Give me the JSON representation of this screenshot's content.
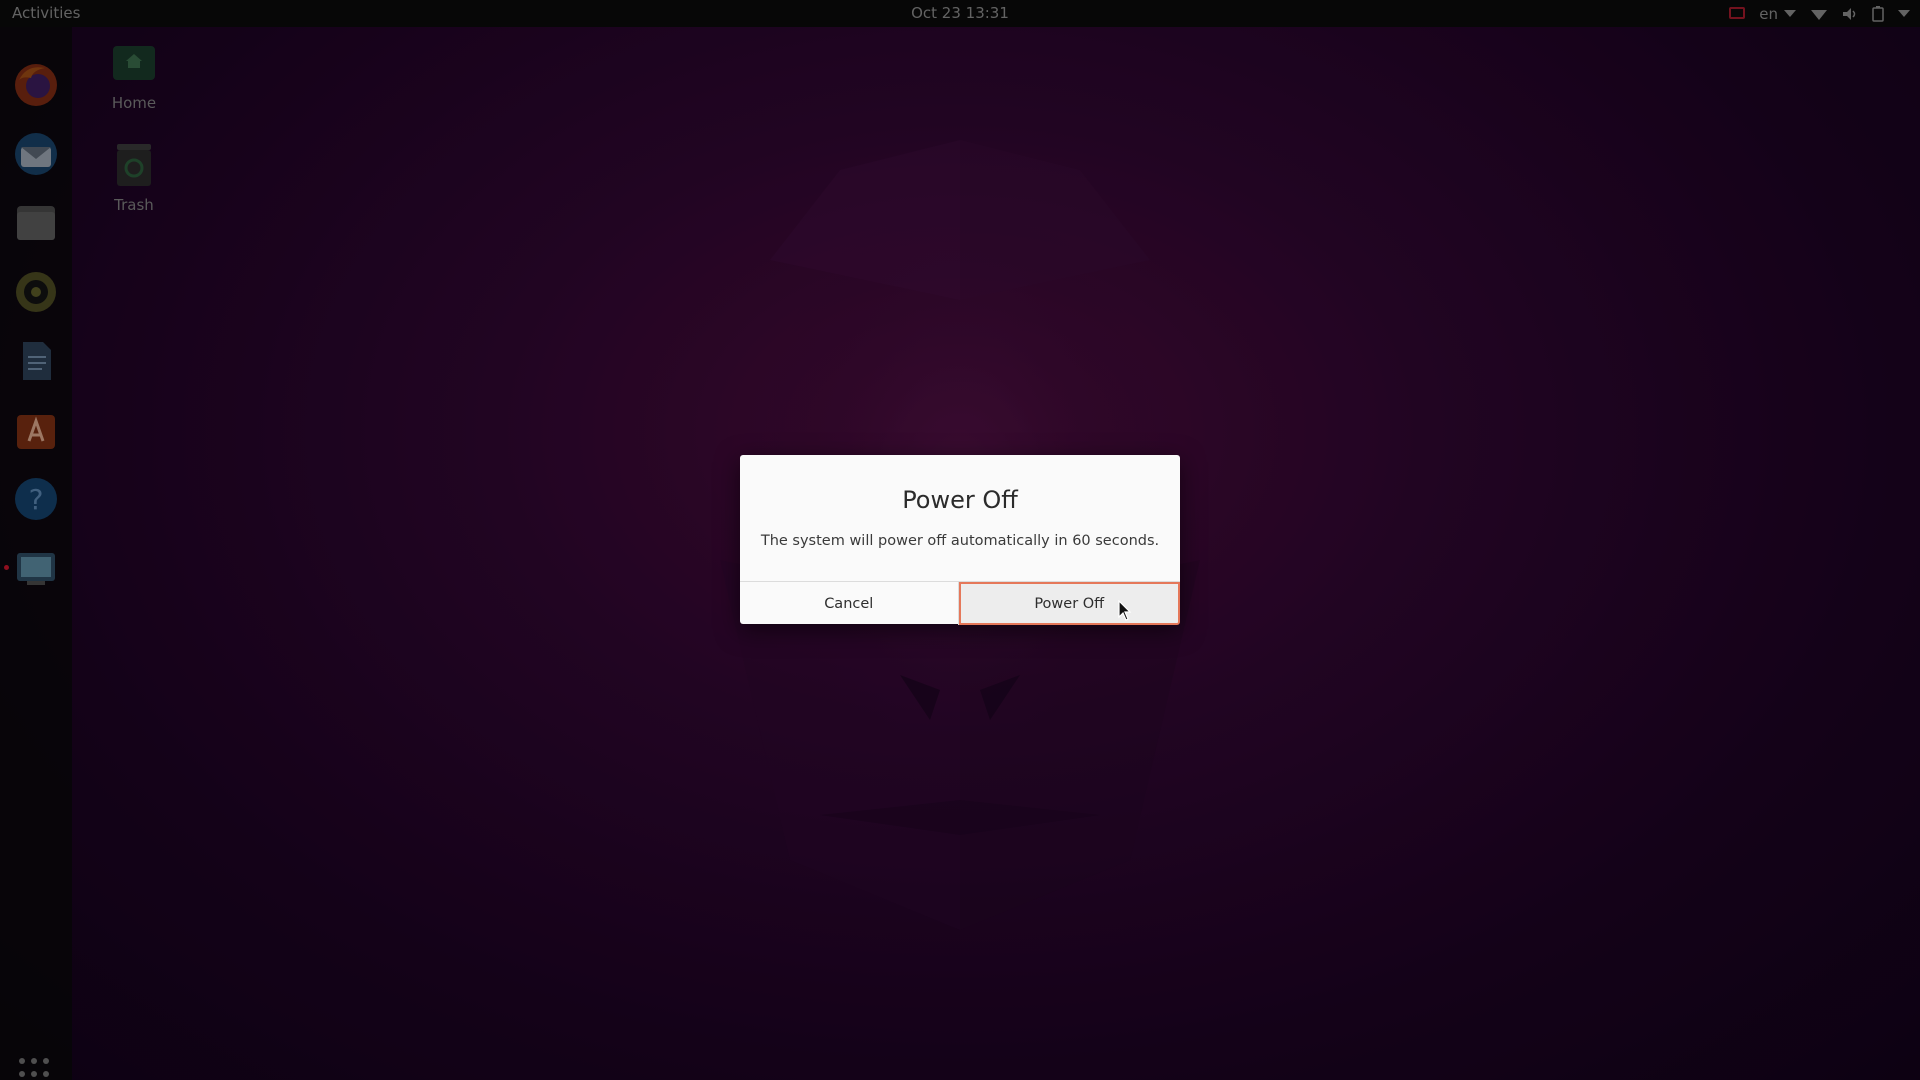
{
  "top_bar": {
    "activities_label": "Activities",
    "clock": "Oct 23  13:31",
    "keyboard_layout": "en",
    "tray_icons": [
      "screen-share-icon",
      "network-wifi-icon",
      "volume-icon",
      "battery-icon",
      "system-menu-chevron-icon"
    ]
  },
  "dock": {
    "items": [
      {
        "name": "firefox-icon"
      },
      {
        "name": "thunderbird-icon"
      },
      {
        "name": "files-icon"
      },
      {
        "name": "rhythmbox-icon"
      },
      {
        "name": "libreoffice-writer-icon"
      },
      {
        "name": "ubuntu-software-icon"
      },
      {
        "name": "help-icon"
      },
      {
        "name": "screenshot-tool-icon"
      }
    ],
    "show_apps_icon": "app-grid-icon"
  },
  "desktop": {
    "icons": [
      {
        "label": "Home",
        "icon": "home-folder-icon"
      },
      {
        "label": "Trash",
        "icon": "trash-icon"
      }
    ]
  },
  "dialog": {
    "title": "Power Off",
    "message": "The system will power off automatically in 60 seconds.",
    "cancel_label": "Cancel",
    "confirm_label": "Power Off",
    "focus_color": "#e5785a"
  },
  "colors": {
    "wallpaper_base": "#2e0730",
    "accent": "#e95420"
  }
}
